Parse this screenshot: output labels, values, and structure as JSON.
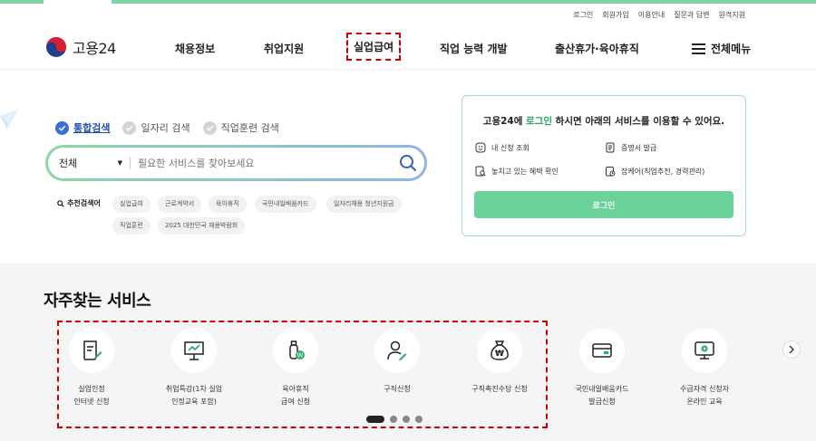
{
  "util_links": [
    "로그인",
    "회원가입",
    "이용안내",
    "질문과 답변",
    "원격지원"
  ],
  "brand": {
    "name": "고용24"
  },
  "nav": {
    "items": [
      "채용정보",
      "취업지원",
      "실업급여",
      "직업 능력 개발",
      "출산휴가·육아휴직"
    ],
    "all_menu": "전체메뉴",
    "highlighted": "실업급여"
  },
  "search": {
    "tabs": [
      {
        "label": "통합검색",
        "active": true
      },
      {
        "label": "일자리 검색",
        "active": false
      },
      {
        "label": "직업훈련 검색",
        "active": false
      }
    ],
    "category": "전체",
    "placeholder": "필요한 서비스를 찾아보세요",
    "reco_label": "추천검색어",
    "keywords": [
      "실업급여",
      "근로계약서",
      "육아휴직",
      "국민내일배움카드",
      "일자리채용 청년지원금",
      "직업훈련",
      "2025 대한민국 채용박람회"
    ]
  },
  "login_box": {
    "title_pre": "고용24에 ",
    "title_link": "로그인",
    "title_post": " 하시면 아래의 서비스를 이용할 수 있어요.",
    "items": [
      "내 신청 조회",
      "증명서 발급",
      "놓치고 있는 혜택 확인",
      "잡케어(직업추천, 경력관리)"
    ],
    "button": "로그인"
  },
  "services": {
    "title": "자주찾는 서비스",
    "items": [
      {
        "label": "실업인정\n인터넷 신청",
        "icon": "document-pen-icon"
      },
      {
        "label": "취업특강(1차 실업\n인정교육 포함)",
        "icon": "presentation-board-icon"
      },
      {
        "label": "육아휴직\n급여 신청",
        "icon": "baby-bottle-won-icon"
      },
      {
        "label": "구직신청",
        "icon": "person-pen-icon"
      },
      {
        "label": "구직촉진수당 신청",
        "icon": "money-bag-icon"
      },
      {
        "label": "국민내일배움카드\n발급신청",
        "icon": "card-icon"
      },
      {
        "label": "수급자격 신청자\n온라인 교육",
        "icon": "monitor-play-icon"
      }
    ],
    "pages": 4,
    "current_page": 1
  },
  "colors": {
    "accent_green": "#69d39a",
    "link_blue": "#1e4fb0",
    "highlight_red": "#d10000"
  }
}
